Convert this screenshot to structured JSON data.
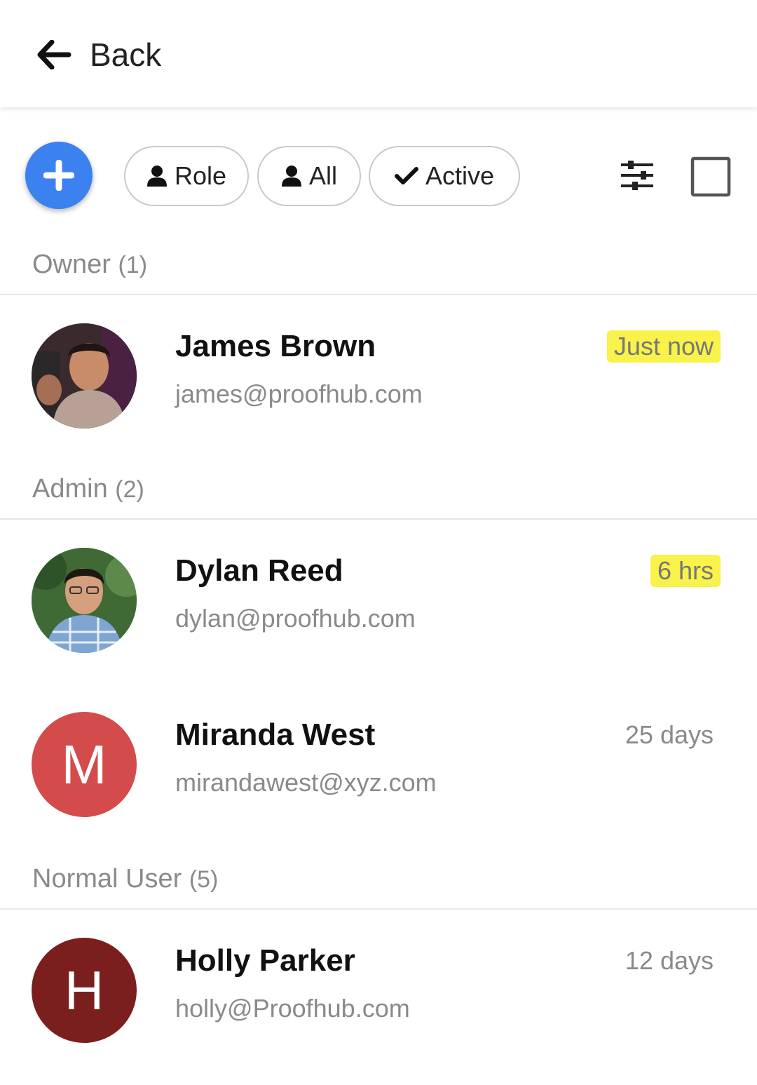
{
  "header": {
    "back_label": "Back",
    "back_icon": "arrow-left-icon"
  },
  "toolbar": {
    "add_icon": "plus-icon",
    "accent_color": "#3b82f0",
    "chips": [
      {
        "label": "Role",
        "icon": "user-icon"
      },
      {
        "label": "All",
        "icon": "user-icon"
      },
      {
        "label": "Active",
        "icon": "check-icon"
      }
    ],
    "filter_icon": "sliders-icon",
    "select_icon": "checkbox-icon"
  },
  "sections": [
    {
      "title": "Owner",
      "count": "(1)",
      "users": [
        {
          "name": "James Brown",
          "email": "james@proofhub.com",
          "time": "Just now",
          "highlight": true,
          "avatar": "photo"
        }
      ]
    },
    {
      "title": "Admin",
      "count": "(2)",
      "users": [
        {
          "name": "Dylan Reed",
          "email": "dylan@proofhub.com",
          "time": "6 hrs",
          "highlight": true,
          "avatar": "photo"
        },
        {
          "name": "Miranda West",
          "email": "mirandawest@xyz.com",
          "time": "25 days",
          "highlight": false,
          "avatar": "M",
          "avatar_color": "#d44b4b"
        }
      ]
    },
    {
      "title": "Normal User",
      "count": "(5)",
      "users": [
        {
          "name": "Holly Parker",
          "email": "holly@Proofhub.com",
          "time": "12 days",
          "highlight": false,
          "avatar": "H",
          "avatar_color": "#7a1e1e"
        }
      ]
    }
  ],
  "highlight_color": "#f8f24a"
}
